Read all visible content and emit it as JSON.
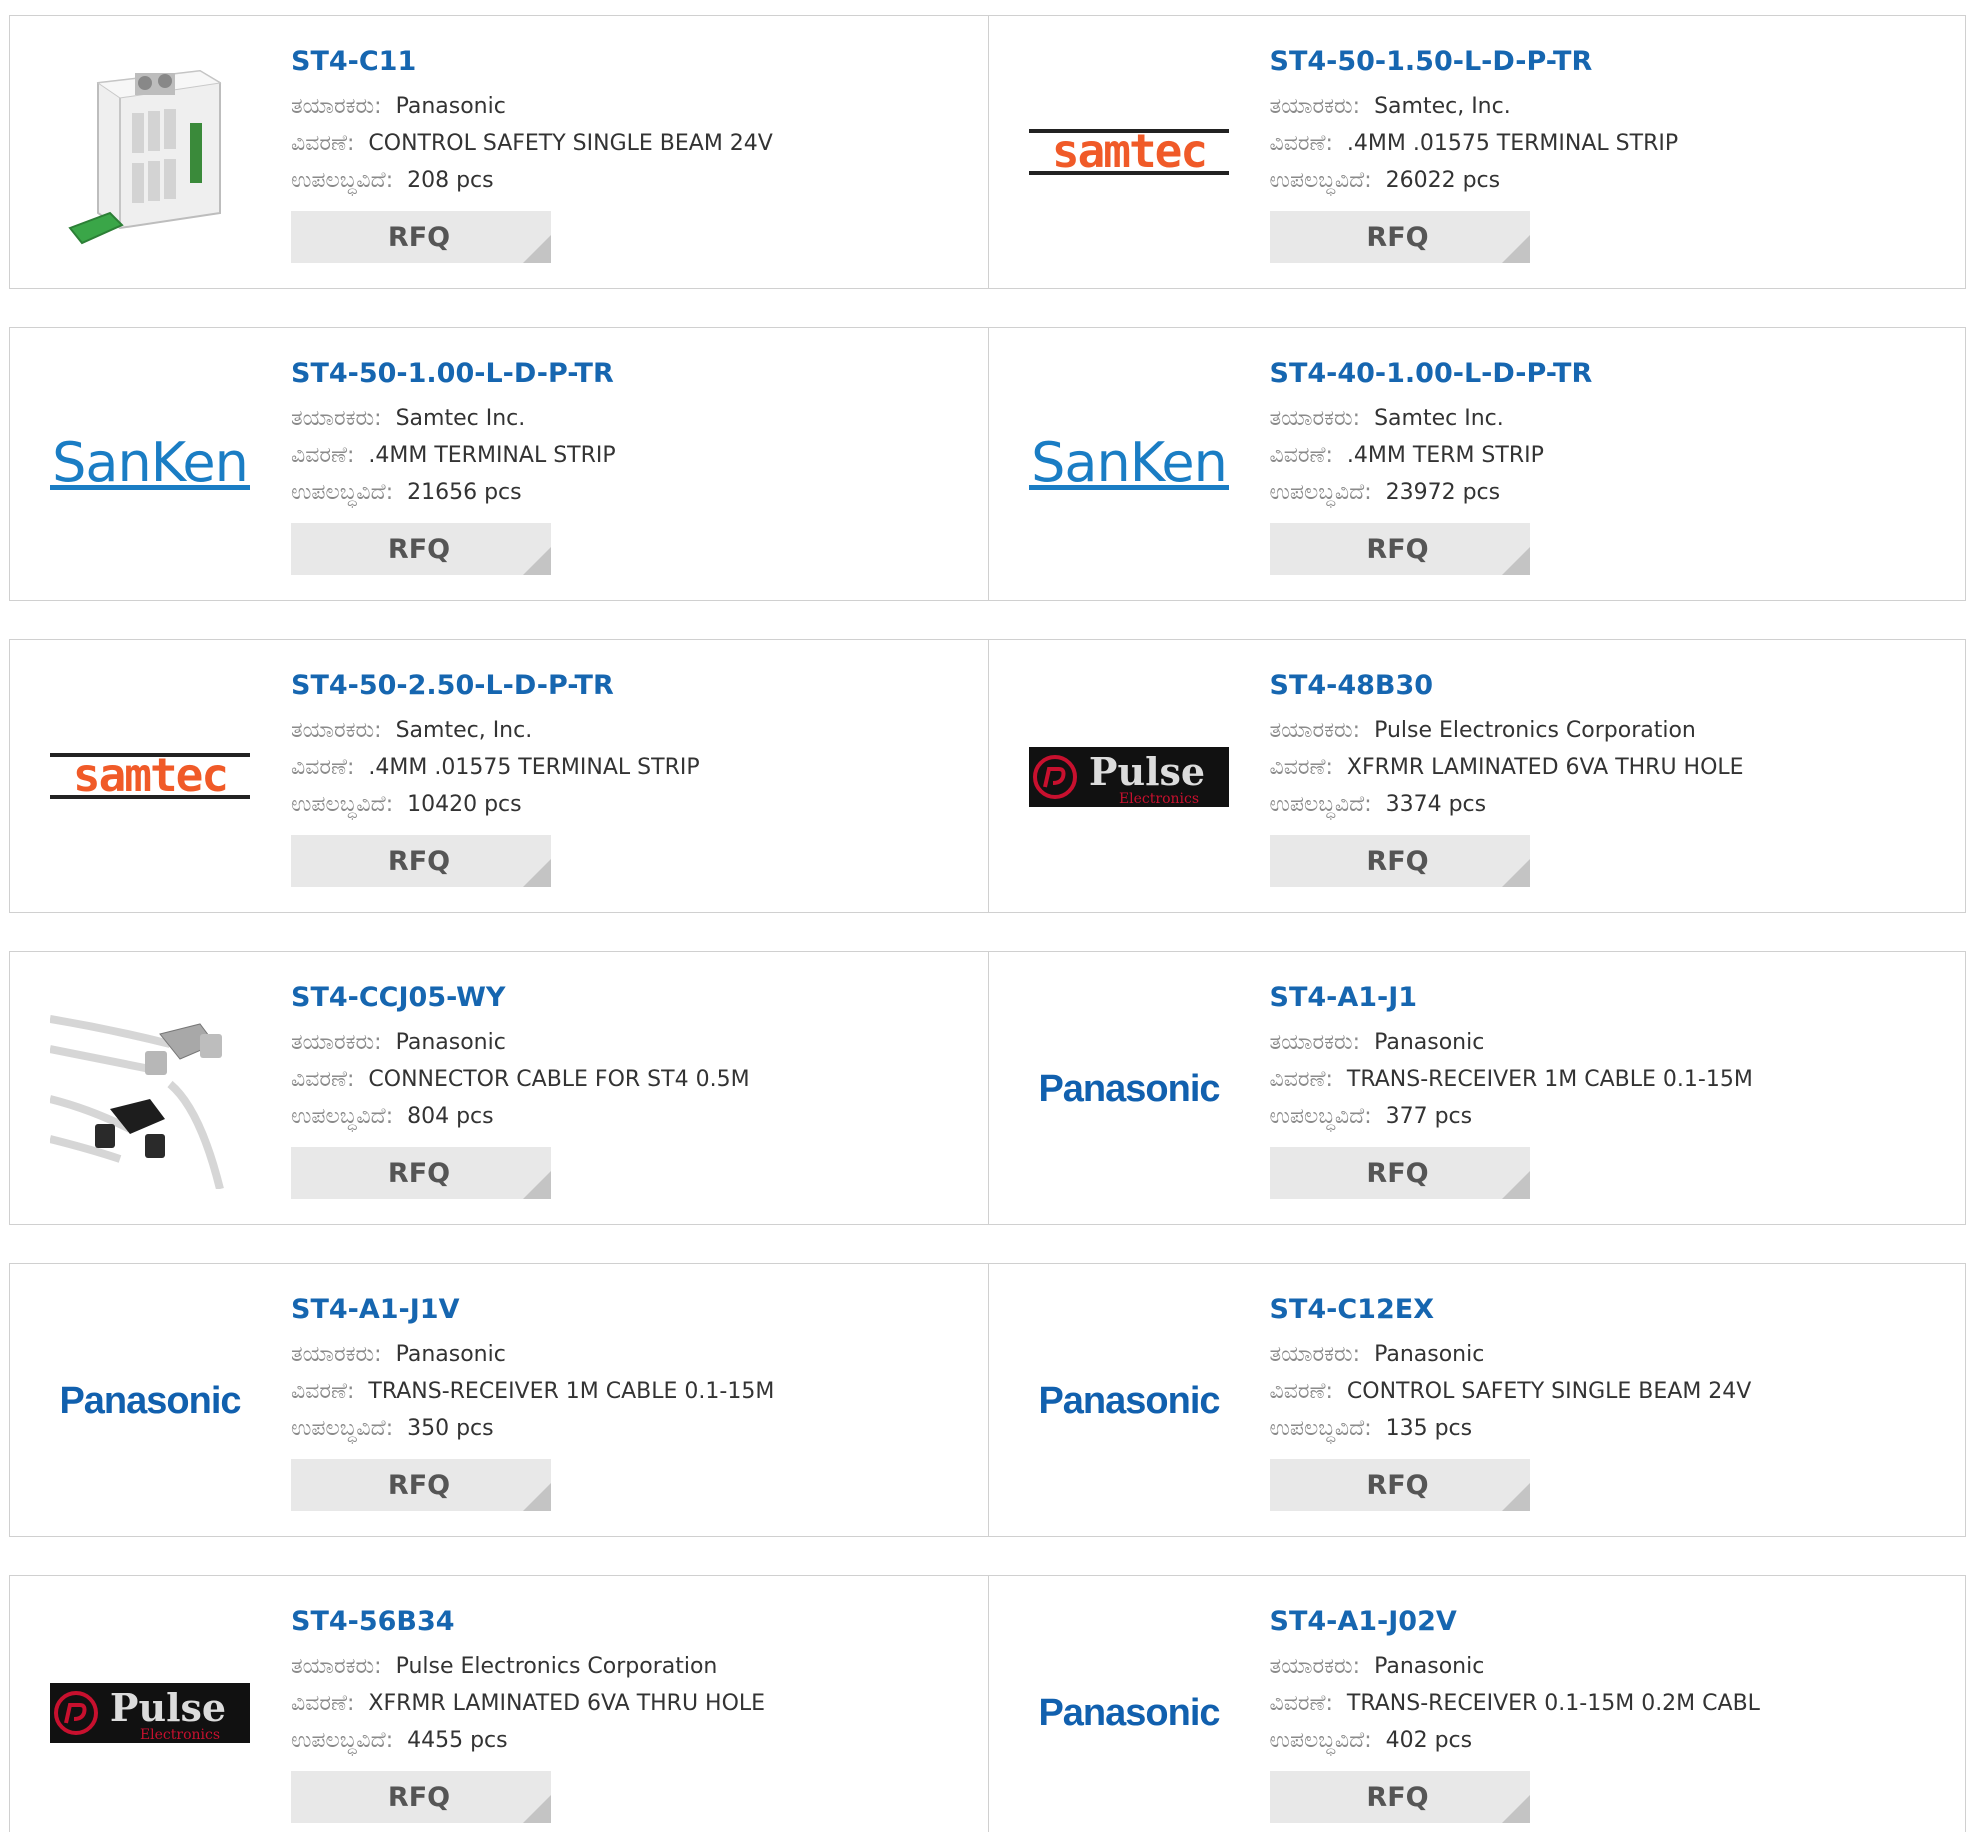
{
  "labels": {
    "manufacturer": "ತಯಾರಕರು:",
    "description": "ವಿವರಣೆ:",
    "available": "ಉಪಲಬ್ಧವಿದೆ:",
    "rfq": "RFQ"
  },
  "colors": {
    "part_link": "#1666b0",
    "label": "#8a8a8a",
    "rfq_bg": "#e8e8e8",
    "samtec_orange": "#f05a28",
    "sanken_blue": "#1a7dc4",
    "panasonic_blue": "#1160ae",
    "pulse_red": "#c8102e"
  },
  "products": [
    {
      "part": "ST4-C11",
      "manufacturer": "Panasonic",
      "description": "CONTROL SAFETY SINGLE BEAM 24V",
      "available": "208 pcs",
      "image": "safety-controller-photo"
    },
    {
      "part": "ST4-50-1.50-L-D-P-TR",
      "manufacturer": "Samtec, Inc.",
      "description": ".4MM .01575 TERMINAL STRIP",
      "available": "26022 pcs",
      "image": "samtec-logo"
    },
    {
      "part": "ST4-50-1.00-L-D-P-TR",
      "manufacturer": "Samtec Inc.",
      "description": ".4MM TERMINAL STRIP",
      "available": "21656 pcs",
      "image": "sanken-logo"
    },
    {
      "part": "ST4-40-1.00-L-D-P-TR",
      "manufacturer": "Samtec Inc.",
      "description": ".4MM TERM STRIP",
      "available": "23972 pcs",
      "image": "sanken-logo"
    },
    {
      "part": "ST4-50-2.50-L-D-P-TR",
      "manufacturer": "Samtec, Inc.",
      "description": ".4MM .01575 TERMINAL STRIP",
      "available": "10420 pcs",
      "image": "samtec-logo"
    },
    {
      "part": "ST4-48B30",
      "manufacturer": "Pulse Electronics Corporation",
      "description": "XFRMR LAMINATED 6VA THRU HOLE",
      "available": "3374 pcs",
      "image": "pulse-logo"
    },
    {
      "part": "ST4-CCJ05-WY",
      "manufacturer": "Panasonic",
      "description": "CONNECTOR CABLE FOR ST4 0.5M",
      "available": "804 pcs",
      "image": "cable-photo"
    },
    {
      "part": "ST4-A1-J1",
      "manufacturer": "Panasonic",
      "description": "TRANS-RECEIVER 1M CABLE 0.1-15M",
      "available": "377 pcs",
      "image": "panasonic-logo"
    },
    {
      "part": "ST4-A1-J1V",
      "manufacturer": "Panasonic",
      "description": "TRANS-RECEIVER 1M CABLE 0.1-15M",
      "available": "350 pcs",
      "image": "panasonic-logo"
    },
    {
      "part": "ST4-C12EX",
      "manufacturer": "Panasonic",
      "description": "CONTROL SAFETY SINGLE BEAM 24V",
      "available": "135 pcs",
      "image": "panasonic-logo"
    },
    {
      "part": "ST4-56B34",
      "manufacturer": "Pulse Electronics Corporation",
      "description": "XFRMR LAMINATED 6VA THRU HOLE",
      "available": "4455 pcs",
      "image": "pulse-logo"
    },
    {
      "part": "ST4-A1-J02V",
      "manufacturer": "Panasonic",
      "description": "TRANS-RECEIVER 0.1-15M 0.2M CABL",
      "available": "402 pcs",
      "image": "panasonic-logo"
    }
  ]
}
